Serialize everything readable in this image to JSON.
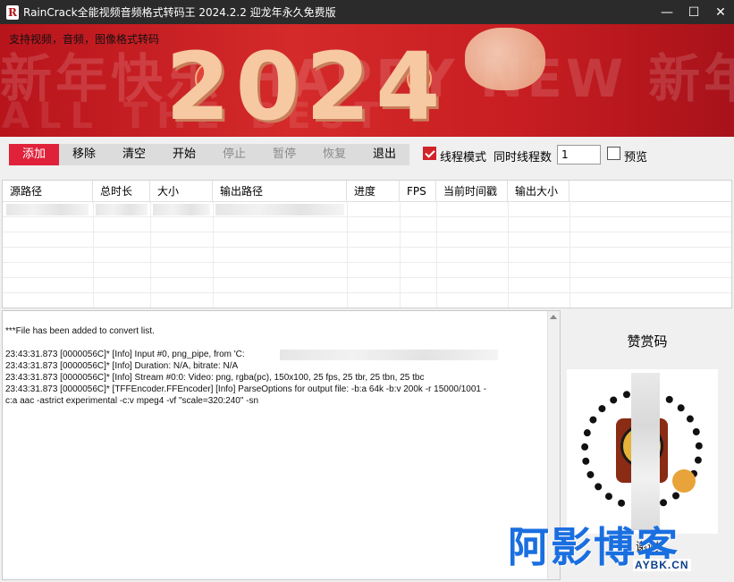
{
  "window": {
    "app_icon": "R",
    "title": "RainCrack全能视频音频格式转码王 2024.2.2 迎龙年永久免费版",
    "minimize": "—",
    "maximize": "☐",
    "close": "✕"
  },
  "banner": {
    "caption": "支持视频，音频，图像格式转码",
    "year": "2024",
    "bg_text": "新年快乐 HAPPY NEW 新年快乐",
    "bg_sub": "ALL THE BEST"
  },
  "toolbar": {
    "add": "添加",
    "remove": "移除",
    "clear": "清空",
    "start": "开始",
    "stop": "停止",
    "pause": "暂停",
    "resume": "恢复",
    "exit": "退出",
    "thread_mode_label": "线程模式",
    "thread_mode_checked": true,
    "threads_label": "同时线程数",
    "threads_value": "1",
    "preview_label": "预览",
    "preview_checked": false,
    "accent": "#e0213a"
  },
  "table": {
    "columns": [
      "源路径",
      "总时长",
      "大小",
      "输出路径",
      "进度",
      "FPS",
      "当前时间戳",
      "输出大小"
    ]
  },
  "log": {
    "lines": [
      "***File has been added to convert list.",
      "",
      "23:43:31.873 [0000056C]* [Info] Input #0, png_pipe, from 'C:",
      "23:43:31.873 [0000056C]* [Info]   Duration: N/A, bitrate: N/A",
      "23:43:31.873 [0000056C]* [Info]   Stream #0:0: Video: png, rgba(pc), 150x100, 25 fps, 25 tbr, 25 tbn, 25 tbc",
      "23:43:31.873 [0000056C]* [TFFEncoder.FFEncoder] [Info] ParseOptions for output file: -b:a 64k -b:v 200k -r 15000/1001 -",
      "c:a aac -astrict experimental -c:v mpeg4 -vf \"scale=320:240\" -sn"
    ]
  },
  "reward": {
    "title": "赞赏码",
    "footer": "谢谢"
  },
  "watermark": {
    "main": "阿影博客",
    "sub": "AYBK.CN"
  }
}
